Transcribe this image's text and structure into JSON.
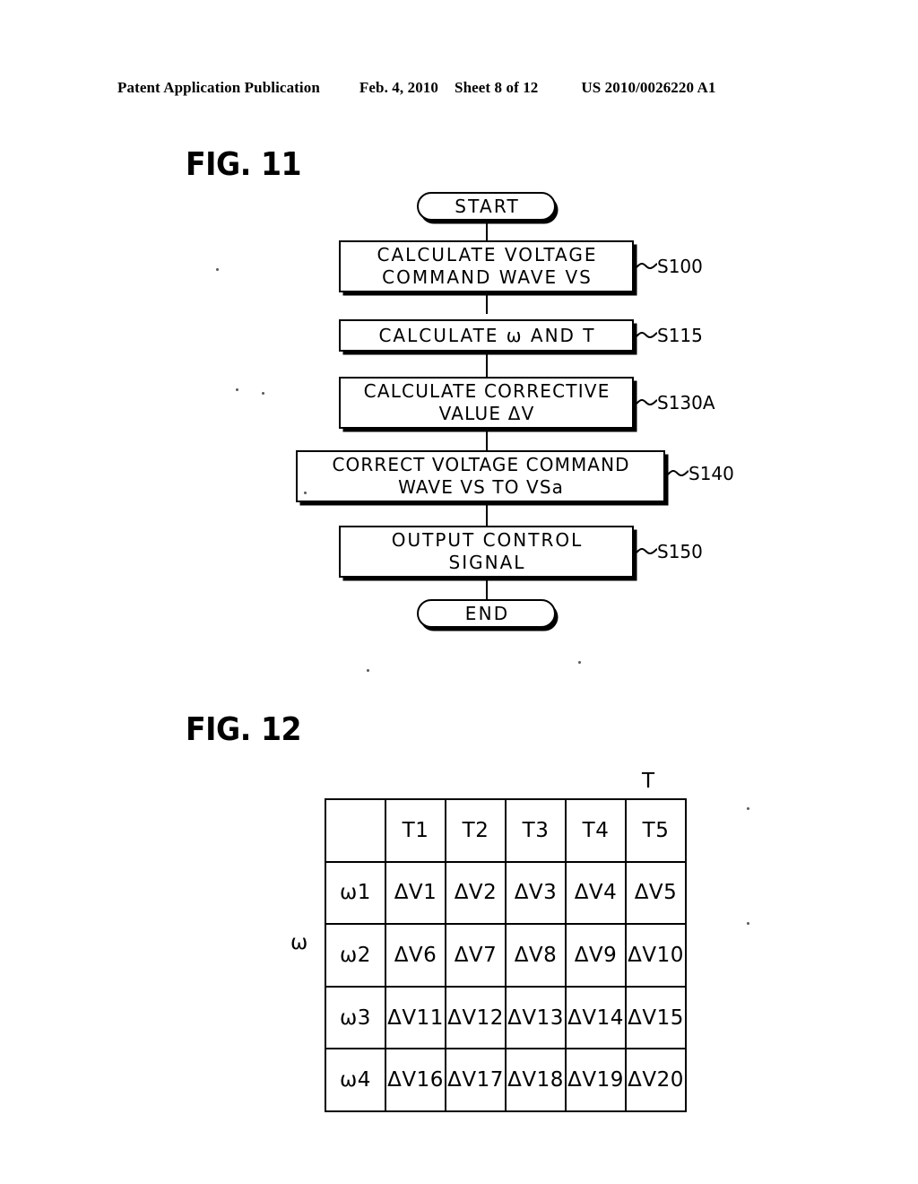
{
  "header": {
    "publication": "Patent Application Publication",
    "date": "Feb. 4, 2010",
    "sheet": "Sheet 8 of 12",
    "patent_number": "US 2010/0026220 A1"
  },
  "figures": [
    {
      "caption": "FIG. 11",
      "type": "flowchart",
      "nodes": [
        {
          "id": "start",
          "shape": "terminator",
          "label": "START",
          "step": ""
        },
        {
          "id": "s100",
          "shape": "process",
          "line1": "CALCULATE VOLTAGE",
          "line2": "COMMAND WAVE VS",
          "step": "S100"
        },
        {
          "id": "s115",
          "shape": "process",
          "line1": "CALCULATE ω AND T",
          "line2": "",
          "step": "S115"
        },
        {
          "id": "s130a",
          "shape": "process",
          "line1": "CALCULATE CORRECTIVE",
          "line2": "VALUE ΔV",
          "step": "S130A"
        },
        {
          "id": "s140",
          "shape": "process",
          "line1": "CORRECT VOLTAGE COMMAND",
          "line2": "WAVE VS TO VSa",
          "step": "S140"
        },
        {
          "id": "s150",
          "shape": "process",
          "line1": "OUTPUT CONTROL",
          "line2": "SIGNAL",
          "step": "S150"
        },
        {
          "id": "end",
          "shape": "terminator",
          "label": "END",
          "step": ""
        }
      ]
    },
    {
      "caption": "FIG. 12",
      "type": "table",
      "axis_top_label": "T",
      "axis_left_label": "ω",
      "corner": "",
      "column_headers": [
        "T1",
        "T2",
        "T3",
        "T4",
        "T5"
      ],
      "row_headers": [
        "ω1",
        "ω2",
        "ω3",
        "ω4"
      ],
      "rows": [
        [
          "ΔV1",
          "ΔV2",
          "ΔV3",
          "ΔV4",
          "ΔV5"
        ],
        [
          "ΔV6",
          "ΔV7",
          "ΔV8",
          "ΔV9",
          "ΔV10"
        ],
        [
          "ΔV11",
          "ΔV12",
          "ΔV13",
          "ΔV14",
          "ΔV15"
        ],
        [
          "ΔV16",
          "ΔV17",
          "ΔV18",
          "ΔV19",
          "ΔV20"
        ]
      ]
    }
  ]
}
